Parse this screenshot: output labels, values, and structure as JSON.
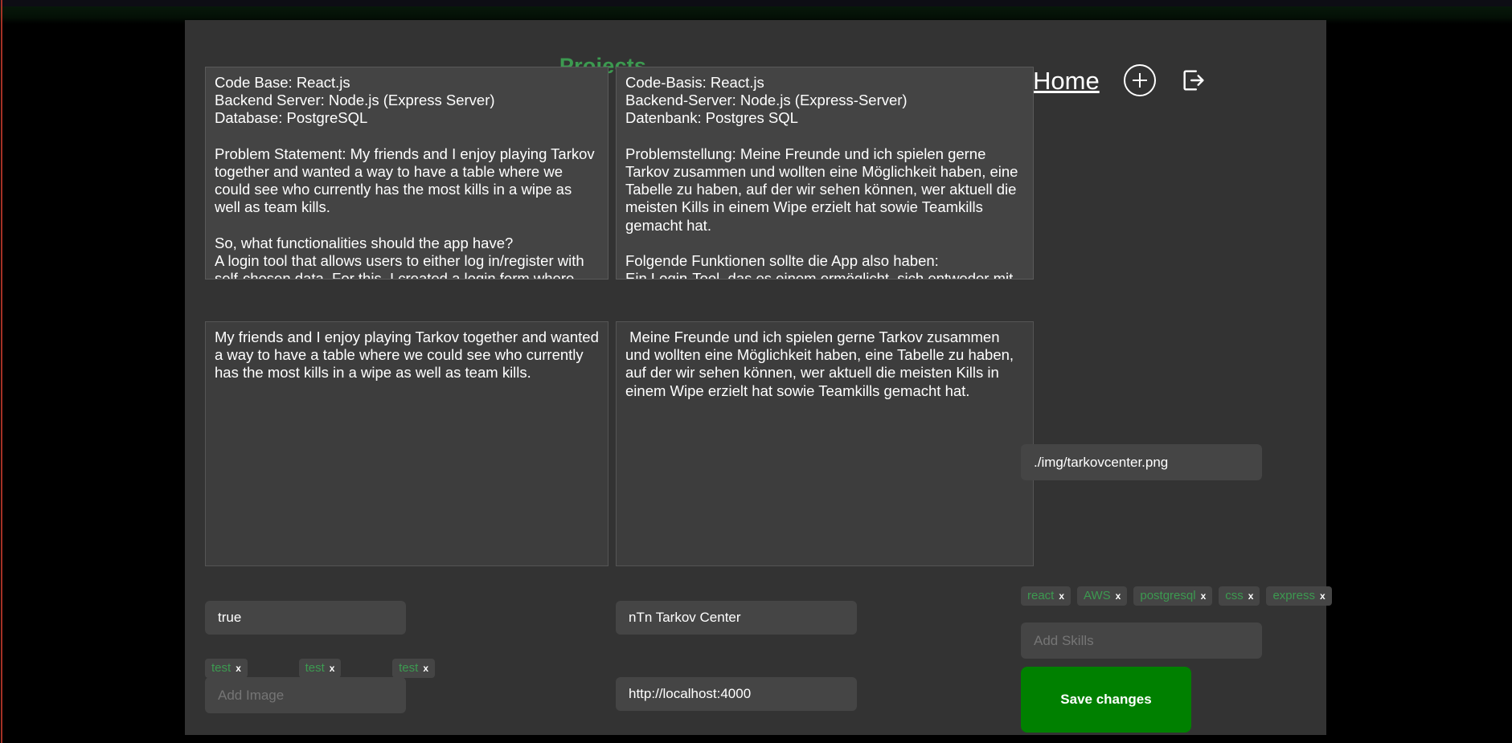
{
  "header": {
    "page_title": "Projects",
    "home_label": "Home",
    "add_icon": "plus-circle-icon",
    "logout_icon": "logout-icon",
    "title_color": "#3c9a50"
  },
  "description_en": {
    "label": "description-long-en",
    "value": "Code Base: React.js\nBackend Server: Node.js (Express Server)\nDatabase: PostgreSQL\n\nProblem Statement: My friends and I enjoy playing Tarkov together and wanted a way to have a table where we could see who currently has the most kills in a wipe as well as team kills.\n\nSo, what functionalities should the app have?\nA login tool that allows users to either log in/register with self-chosen data. For this, I created a login form where users can log in via OAuth or with an account. If users register with an account, the password is hashed in the"
  },
  "description_de": {
    "label": "description-long-de",
    "value": "Code-Basis: React.js\nBackend-Server: Node.js (Express-Server)\nDatenbank: Postgres SQL\n\nProblemstellung: Meine Freunde und ich spielen gerne Tarkov zusammen und wollten eine Möglichkeit haben, eine Tabelle zu haben, auf der wir sehen können, wer aktuell die meisten Kills in einem Wipe erzielt hat sowie Teamkills gemacht hat.\n\nFolgende Funktionen sollte die App also haben:\nEin Login-Tool, das es einem ermöglicht, sich entweder mit selbst gewählten Daten einzuloggen/zu registrieren. Dafür habe ich ein Login-Formular erstellt, bei dem man"
  },
  "short_en": {
    "label": "description-short-en",
    "value": "My friends and I enjoy playing Tarkov together and wanted a way to have a table where we could see who currently has the most kills in a wipe as well as team kills."
  },
  "short_de": {
    "label": "description-short-de",
    "value": " Meine Freunde und ich spielen gerne Tarkov zusammen und wollten eine Möglichkeit haben, eine Tabelle zu haben, auf der wir sehen können, wer aktuell die meisten Kills in einem Wipe erzielt hat sowie Teamkills gemacht hat."
  },
  "fields": {
    "bool_value": "true",
    "add_image_placeholder": "Add Image",
    "add_image_value": "",
    "project_name": "nTn Tarkov Center",
    "project_url": "http://localhost:4000",
    "image_path": "./img/tarkovcenter.png",
    "add_skills_placeholder": "Add Skills",
    "add_skills_value": ""
  },
  "image_tags": [
    {
      "label": "test",
      "remove": "x"
    },
    {
      "label": "test",
      "remove": "x"
    },
    {
      "label": "test",
      "remove": "x"
    }
  ],
  "skill_tags": [
    {
      "label": "react",
      "remove": "x"
    },
    {
      "label": "AWS",
      "remove": "x"
    },
    {
      "label": "postgresql",
      "remove": "x"
    },
    {
      "label": "css",
      "remove": "x"
    },
    {
      "label": "express",
      "remove": "x"
    }
  ],
  "actions": {
    "save_label": "Save changes",
    "save_color": "#008000"
  }
}
